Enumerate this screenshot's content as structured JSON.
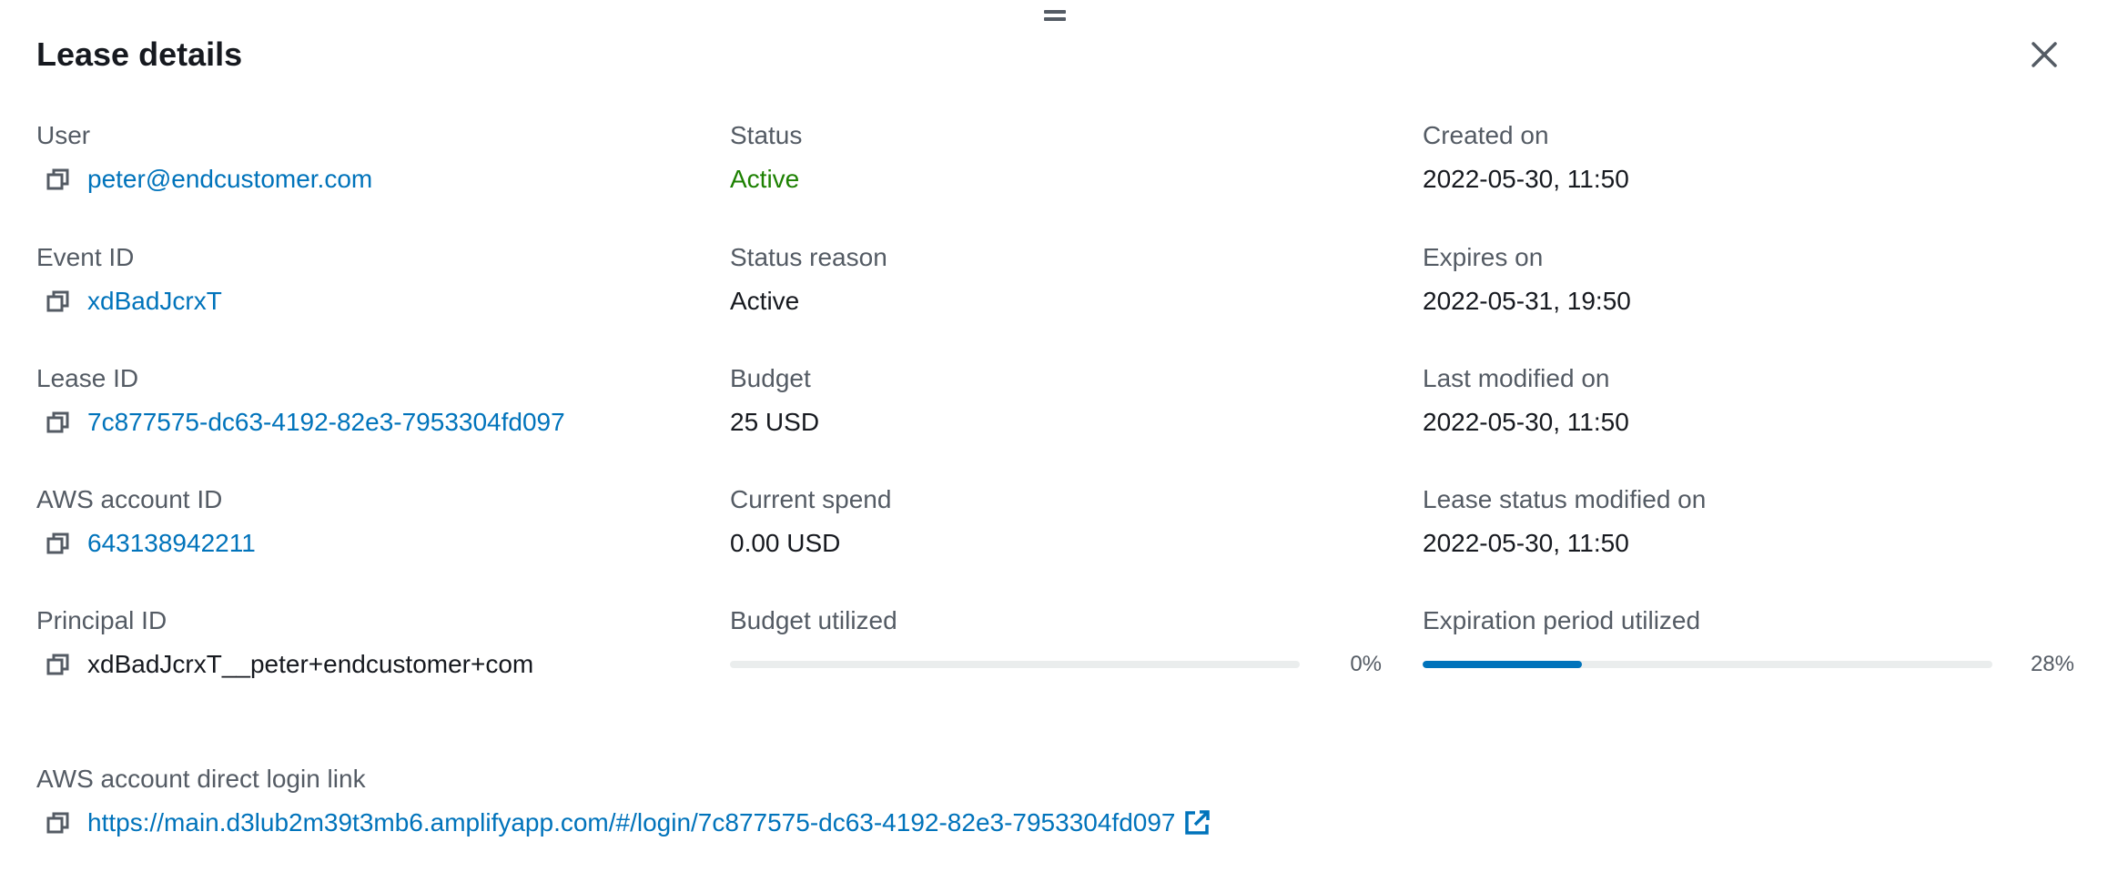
{
  "header": {
    "title": "Lease details"
  },
  "fields": {
    "user": {
      "label": "User",
      "value": "peter@endcustomer.com"
    },
    "event_id": {
      "label": "Event ID",
      "value": "xdBadJcrxT"
    },
    "lease_id": {
      "label": "Lease ID",
      "value": "7c877575-dc63-4192-82e3-7953304fd097"
    },
    "account_id": {
      "label": "AWS account ID",
      "value": "643138942211"
    },
    "principal_id": {
      "label": "Principal ID",
      "value": "xdBadJcrxT__peter+endcustomer+com"
    },
    "status": {
      "label": "Status",
      "value": "Active",
      "color": "#1d8102"
    },
    "status_reason": {
      "label": "Status reason",
      "value": "Active"
    },
    "budget": {
      "label": "Budget",
      "value": "25 USD"
    },
    "current_spend": {
      "label": "Current spend",
      "value": "0.00 USD"
    },
    "budget_utilized": {
      "label": "Budget utilized",
      "percent": 0,
      "percent_label": "0%"
    },
    "created_on": {
      "label": "Created on",
      "value": "2022-05-30, 11:50"
    },
    "expires_on": {
      "label": "Expires on",
      "value": "2022-05-31, 19:50"
    },
    "last_modified": {
      "label": "Last modified on",
      "value": "2022-05-30, 11:50"
    },
    "status_modified": {
      "label": "Lease status modified on",
      "value": "2022-05-30, 11:50"
    },
    "expiration_utilized": {
      "label": "Expiration period utilized",
      "percent": 28,
      "percent_label": "28%"
    },
    "login_link": {
      "label": "AWS account direct login link",
      "value": "https://main.d3lub2m39t3mb6.amplifyapp.com/#/login/7c877575-dc63-4192-82e3-7953304fd097"
    }
  },
  "icons": {
    "copy": "copy-icon",
    "close": "close-icon",
    "external": "external-link-icon",
    "drag": "drag-handle-icon"
  },
  "colors": {
    "link": "#0073bb",
    "progress": "#0073bb",
    "track": "#eaeded",
    "success": "#1d8102"
  }
}
